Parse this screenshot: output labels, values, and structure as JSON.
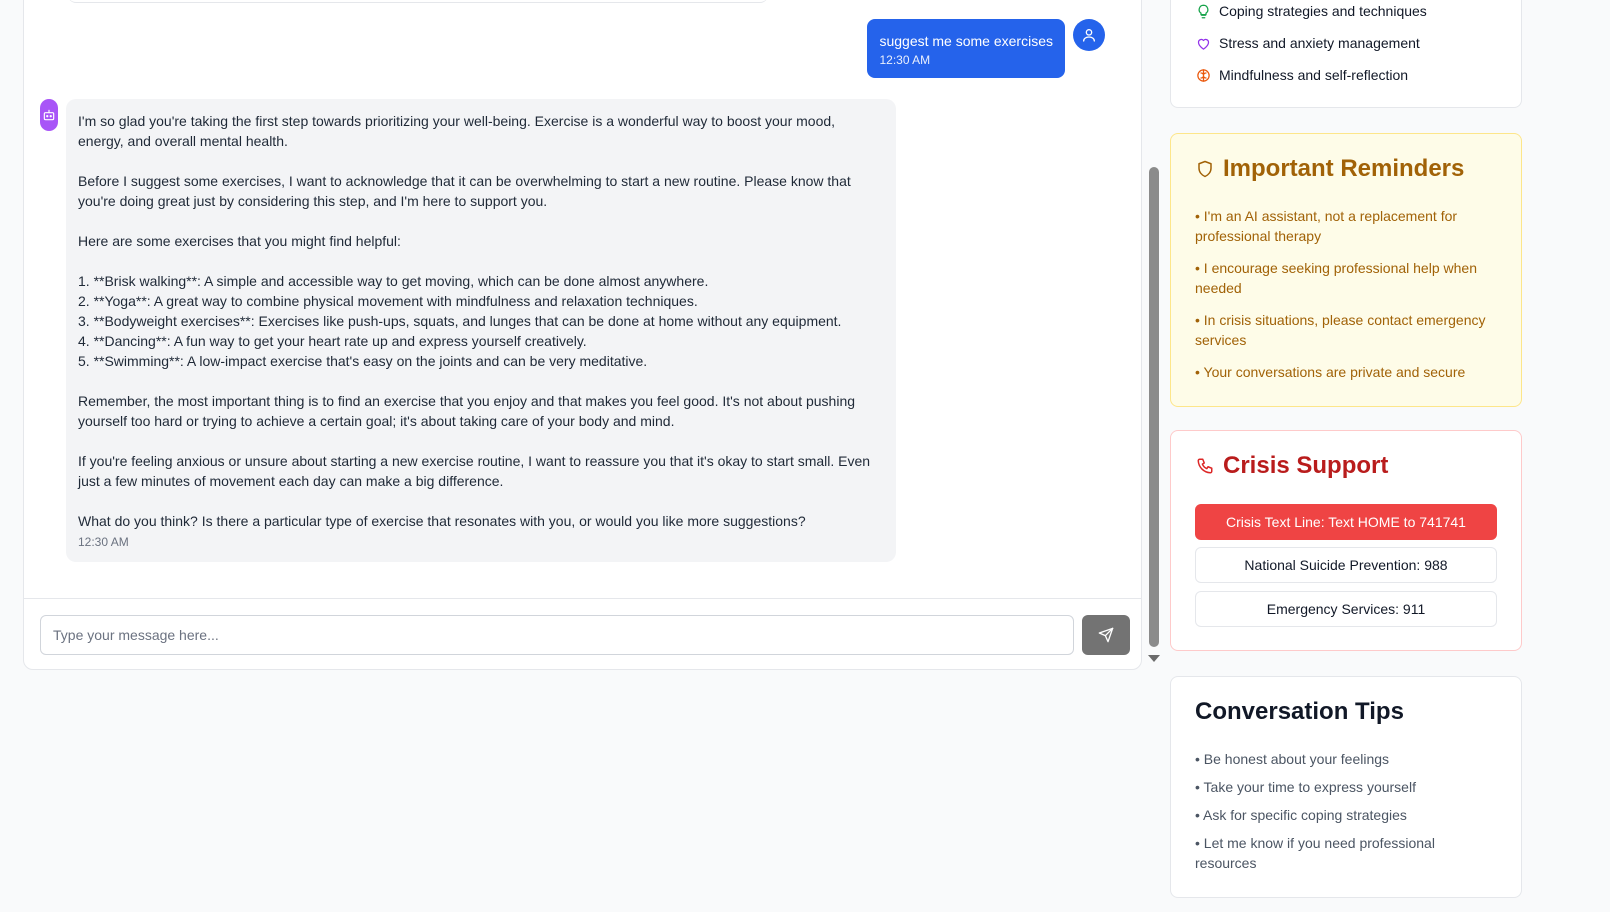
{
  "chat": {
    "user_message": {
      "text": "suggest me some exercises",
      "time": "12:30 AM"
    },
    "bot_message": {
      "p1": "I'm so glad you're taking the first step towards prioritizing your well-being. Exercise is a wonderful way to boost your mood, energy, and overall mental health.",
      "p2": "Before I suggest some exercises, I want to acknowledge that it can be overwhelming to start a new routine. Please know that you're doing great just by considering this step, and I'm here to support you.",
      "p3": "Here are some exercises that you might find helpful:",
      "list": [
        "1. **Brisk walking**: A simple and accessible way to get moving, which can be done almost anywhere.",
        "2. **Yoga**: A great way to combine physical movement with mindfulness and relaxation techniques.",
        "3. **Bodyweight exercises**: Exercises like push-ups, squats, and lunges that can be done at home without any equipment.",
        "4. **Dancing**: A fun way to get your heart rate up and express yourself creatively.",
        "5. **Swimming**: A low-impact exercise that's easy on the joints and can be very meditative."
      ],
      "p4": "Remember, the most important thing is to find an exercise that you enjoy and that makes you feel good. It's not about pushing yourself too hard or trying to achieve a certain goal; it's about taking care of your body and mind.",
      "p5": "If you're feeling anxious or unsure about starting a new exercise routine, I want to reassure you that it's okay to start small. Even just a few minutes of movement each day can make a big difference.",
      "p6": "What do you think? Is there a particular type of exercise that resonates with you, or would you like more suggestions?",
      "time": "12:30 AM"
    },
    "input": {
      "placeholder": "Type your message here...",
      "value": ""
    }
  },
  "topics": [
    {
      "label": "Coping strategies and techniques",
      "icon": "lightbulb-icon",
      "color": "#16a34a"
    },
    {
      "label": "Stress and anxiety management",
      "icon": "heart-icon",
      "color": "#9333ea"
    },
    {
      "label": "Mindfulness and self-reflection",
      "icon": "brain-icon",
      "color": "#ea580c"
    }
  ],
  "reminders": {
    "title": "Important Reminders",
    "items": [
      "• I'm an AI assistant, not a replacement for professional therapy",
      "• I encourage seeking professional help when needed",
      "• In crisis situations, please contact emergency services",
      "• Your conversations are private and secure"
    ]
  },
  "crisis": {
    "title": "Crisis Support",
    "buttons": [
      "Crisis Text Line: Text HOME to 741741",
      "National Suicide Prevention: 988",
      "Emergency Services: 911"
    ]
  },
  "tips": {
    "title": "Conversation Tips",
    "items": [
      "• Be honest about your feelings",
      "• Take your time to express yourself",
      "• Ask for specific coping strategies",
      "• Let me know if you need professional resources"
    ]
  },
  "colors": {
    "accent": "#2563eb",
    "bot": "#a855f7",
    "reminder": "#a16207",
    "crisis": "#dc2626"
  }
}
